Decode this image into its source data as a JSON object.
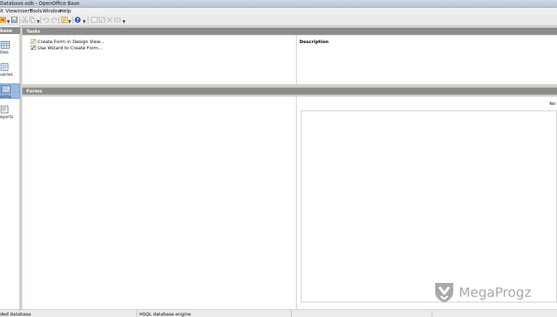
{
  "window": {
    "title": "Database.odb - OpenOffice Base"
  },
  "menu": {
    "items": [
      "it",
      "View",
      "Insert",
      "Tools",
      "Window",
      "Help"
    ]
  },
  "toolbar": {
    "buttons": [
      "new-icon",
      "save-icon",
      "cut-icon",
      "copy-icon",
      "paste-icon",
      "undo-icon",
      "redo-icon",
      "form-icon",
      "help-icon",
      "open-db-object-icon",
      "edit-icon",
      "delete-icon",
      "rename-icon",
      "more-icon"
    ]
  },
  "database_panel": {
    "header": "base",
    "items": [
      {
        "label": "bles",
        "icon": "tables-icon",
        "selected": false
      },
      {
        "label": "ueries",
        "icon": "queries-icon",
        "selected": false
      },
      {
        "label": "orms",
        "icon": "forms-icon",
        "selected": true
      },
      {
        "label": "eports",
        "icon": "reports-icon",
        "selected": false
      }
    ]
  },
  "tasks": {
    "header": "Tasks",
    "items": [
      {
        "label": "Create Form in Design View...",
        "icon": "design-view-icon"
      },
      {
        "label": "Use Wizard to Create Form...",
        "icon": "wizard-icon"
      }
    ],
    "description_label": "Description"
  },
  "forms": {
    "header": "Forms",
    "preview_text": "No"
  },
  "watermark": {
    "text": "MegaProgz"
  },
  "status": {
    "left": "ded database",
    "middle": "HSQL database engine"
  },
  "colors": {
    "section_header": "#8c8c8c",
    "selection": "#99b8e0",
    "background": "#d4d0c8"
  }
}
